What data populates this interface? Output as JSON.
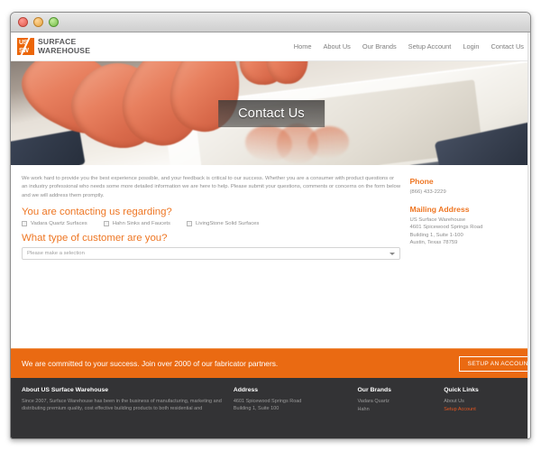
{
  "window": {
    "controls": [
      "close",
      "minimize",
      "zoom"
    ]
  },
  "header": {
    "logo": {
      "mark_line1": "US",
      "mark_line2": "SW",
      "line1": "SURFACE",
      "line2": "WAREHOUSE",
      "color": "#ec6608"
    },
    "nav": [
      {
        "label": "Home"
      },
      {
        "label": "About Us"
      },
      {
        "label": "Our Brands"
      },
      {
        "label": "Setup Account"
      },
      {
        "label": "Login"
      },
      {
        "label": "Contact Us"
      }
    ]
  },
  "hero": {
    "title": "Contact Us"
  },
  "main": {
    "intro": "We work hard to provide you the best experience possible, and your feedback is critical to our success. Whether you are a consumer with product questions or an industry professional who needs some more detailed information we are here to help. Please submit your questions, comments or concerns on the form below and we will address them promptly.",
    "regarding_heading": "You are contacting us regarding?",
    "checkboxes": [
      {
        "label": "Vadara Quartz Surfaces",
        "checked": false
      },
      {
        "label": "Hahn Sinks and Faucets",
        "checked": false
      },
      {
        "label": "LivingStone Solid Surfaces",
        "checked": false
      }
    ],
    "customer_type_heading": "What type of customer are you?",
    "customer_select": {
      "value": "Please make a selection",
      "placeholder": "Please make a selection"
    }
  },
  "sidebar": {
    "phone_heading": "Phone",
    "phone_value": "(866) 433-2229",
    "address_heading": "Mailing Address",
    "address_lines": "US Surface Warehouse\n4601 Spicewood Springs Road\nBuilding 1, Suite 1-100\nAustin, Texas 78759"
  },
  "cta": {
    "text": "We are committed to your success. Join over 2000 of our fabricator partners.",
    "button_label": "SETUP AN ACCOUNT",
    "background": "#ea6a12"
  },
  "footer": {
    "about_heading": "About US Surface Warehouse",
    "about_text": "Since 2007, Surface Warehouse has been in the business of manufacturing, marketing and distributing premium quality, cost effective building products to both residential and",
    "address_heading": "Address",
    "address_text": "4601 Spicewood Springs Road\nBuilding 1, Suite 100",
    "brands_heading": "Our Brands",
    "brands": [
      {
        "label": "Vadara Quartz"
      },
      {
        "label": "Hahn"
      }
    ],
    "links_heading": "Quick Links",
    "links": [
      {
        "label": "About Us",
        "accent": false
      },
      {
        "label": "Setup Account",
        "accent": true
      }
    ],
    "accent_color": "#e8571f",
    "background": "#333335"
  }
}
